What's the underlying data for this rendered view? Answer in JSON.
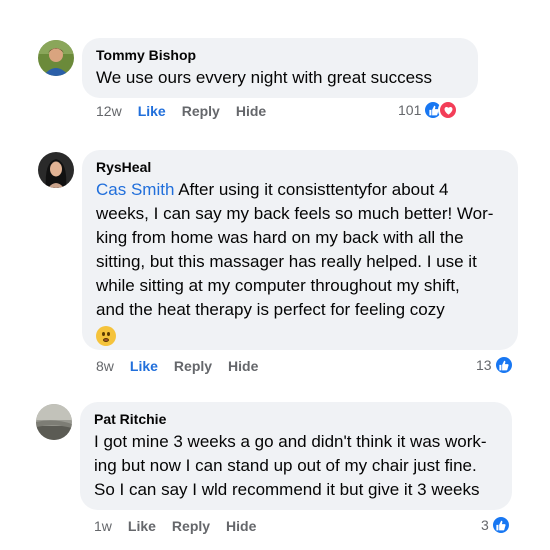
{
  "comments": [
    {
      "author": "Tommy Bishop",
      "text": "We use ours evvery night with great success",
      "time": "12w",
      "like": "Like",
      "reply": "Reply",
      "hide": "Hide",
      "reaction_count": "101",
      "like_active": true,
      "reactions": [
        "like-icon",
        "love-icon"
      ]
    },
    {
      "author": "RysHeal",
      "mention": "Cas Smith",
      "text_lines": [
        " After using it consisttentyfor about 4",
        "weeks, I can say my back feels so much better! Wor-",
        "king from home was hard on my back with all the",
        "sitting, but this massager has really helped. I use it",
        "while sitting at my computer throughout my shift,",
        "and the heat therapy is perfect for feeling cozy"
      ],
      "emoji": "slightly-frowning-emoji",
      "time": "8w",
      "like": "Like",
      "reply": "Reply",
      "hide": "Hide",
      "reaction_count": "13",
      "like_active": true,
      "reactions": [
        "like-icon"
      ]
    },
    {
      "author": "Pat Ritchie",
      "text_lines": [
        "I got mine 3 weeks a go and didn't think it was work-",
        "ing but now I can stand up out of my chair just fine.",
        "So I can say I wld recommend it but give it 3 weeks"
      ],
      "time": "1w",
      "like": "Like",
      "reply": "Reply",
      "hide": "Hide",
      "reaction_count": "3",
      "like_active": false,
      "reactions": [
        "like-icon"
      ]
    }
  ],
  "colors": {
    "bubble": "#f0f2f5",
    "mention": "#216fdb",
    "like_blue": "#1877f2",
    "love_red": "#f33e58",
    "meta_gray": "#65676b"
  }
}
